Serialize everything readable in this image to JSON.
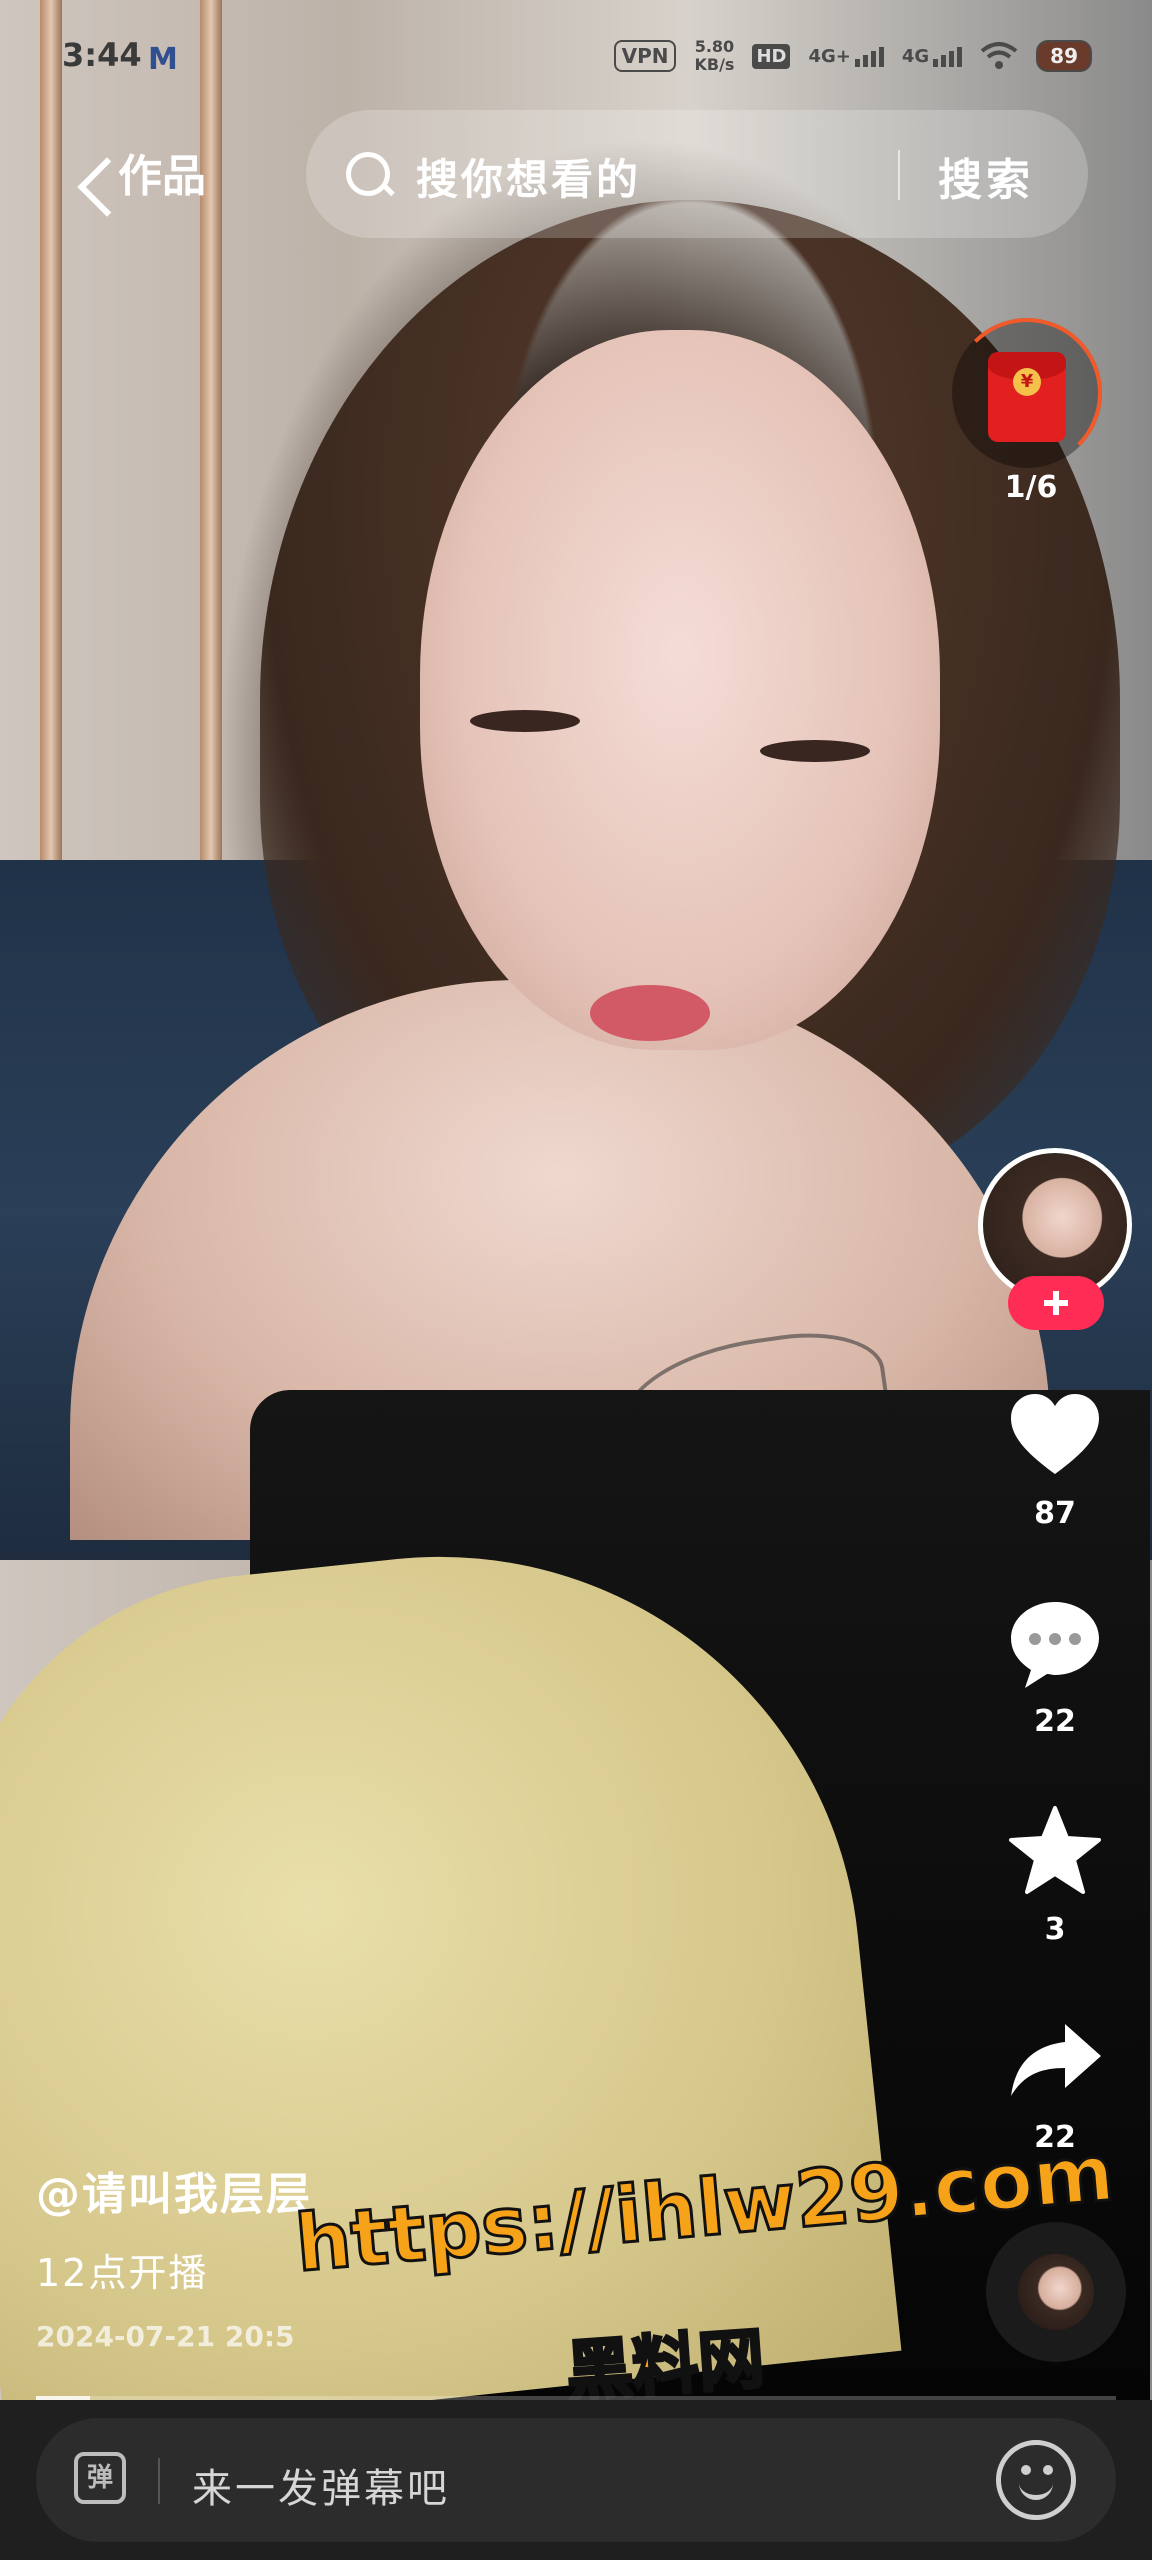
{
  "status_bar": {
    "time": "3:44",
    "mail_icon": "M",
    "vpn": "VPN",
    "speed_value": "5.80",
    "speed_unit": "KB/s",
    "hd": "HD",
    "network1": "4G+",
    "network2": "4G",
    "battery": "89"
  },
  "top_nav": {
    "title": "作品",
    "search_placeholder": "搜你想看的",
    "search_button": "搜索"
  },
  "red_packet": {
    "count": "1/6"
  },
  "actions": {
    "likes": "87",
    "comments": "22",
    "favorites": "3",
    "shares": "22"
  },
  "video_info": {
    "author": "@请叫我层层",
    "caption": "12点开播",
    "date": "2024-07-21 20:5"
  },
  "watermark": {
    "url": "https://ihlw29.com",
    "name": "黑料网"
  },
  "progress": {
    "fraction": 0.05
  },
  "bottom_bar": {
    "danmaku_icon": "弹",
    "danmaku_placeholder": "来一发弹幕吧"
  },
  "icons": {
    "back": "chevron-left-icon",
    "search": "search-icon",
    "red_packet": "red-envelope-icon",
    "like": "heart-icon",
    "comment": "comment-bubble-icon",
    "favorite": "star-icon",
    "share": "share-arrow-icon",
    "emoji": "smiley-icon"
  },
  "colors": {
    "follow_accent": "#ff2d55",
    "watermark": "#f7a31a",
    "red_packet": "#e32020"
  }
}
